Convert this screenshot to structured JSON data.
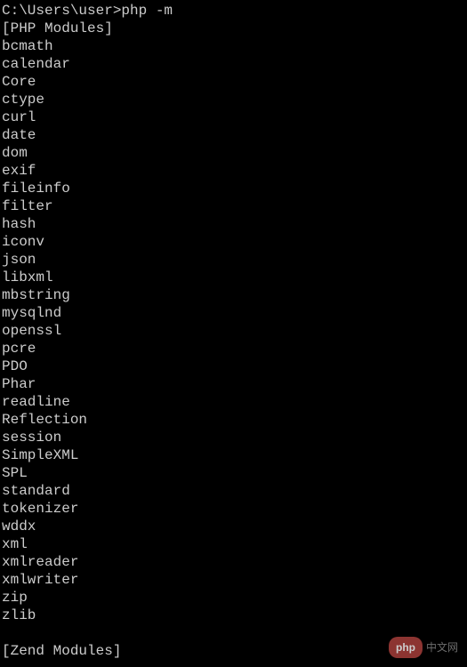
{
  "prompt": {
    "path": "C:\\Users\\user>",
    "command": "php -m"
  },
  "output": {
    "php_modules_header": "[PHP Modules]",
    "modules": [
      "bcmath",
      "calendar",
      "Core",
      "ctype",
      "curl",
      "date",
      "dom",
      "exif",
      "fileinfo",
      "filter",
      "hash",
      "iconv",
      "json",
      "libxml",
      "mbstring",
      "mysqlnd",
      "openssl",
      "pcre",
      "PDO",
      "Phar",
      "readline",
      "Reflection",
      "session",
      "SimpleXML",
      "SPL",
      "standard",
      "tokenizer",
      "wddx",
      "xml",
      "xmlreader",
      "xmlwriter",
      "zip",
      "zlib"
    ],
    "zend_modules_header": "[Zend Modules]"
  },
  "watermark": {
    "badge": "php",
    "text": "中文网"
  }
}
